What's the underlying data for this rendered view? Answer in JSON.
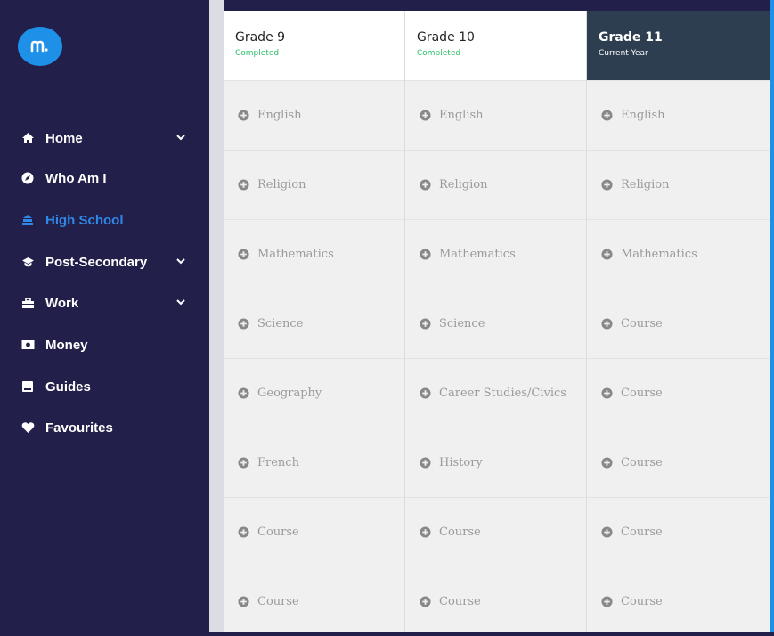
{
  "sidebar": {
    "logo_text": "m",
    "items": [
      {
        "label": "Home",
        "icon": "home-icon",
        "has_chevron": true
      },
      {
        "label": "Who Am I",
        "icon": "compass-icon",
        "has_chevron": false
      },
      {
        "label": "High School",
        "icon": "school-icon",
        "has_chevron": false,
        "active": true
      },
      {
        "label": "Post-Secondary",
        "icon": "graduation-cap-icon",
        "has_chevron": true
      },
      {
        "label": "Work",
        "icon": "briefcase-icon",
        "has_chevron": true
      },
      {
        "label": "Money",
        "icon": "money-icon",
        "has_chevron": false
      },
      {
        "label": "Guides",
        "icon": "book-icon",
        "has_chevron": false
      },
      {
        "label": "Favourites",
        "icon": "heart-icon",
        "has_chevron": false
      }
    ]
  },
  "grades": [
    {
      "title": "Grade 9",
      "status": "Completed",
      "current": false,
      "courses": [
        "English",
        "Religion",
        "Mathematics",
        "Science",
        "Geography",
        "French",
        "Course",
        "Course"
      ]
    },
    {
      "title": "Grade 10",
      "status": "Completed",
      "current": false,
      "courses": [
        "English",
        "Religion",
        "Mathematics",
        "Science",
        "Career Studies/Civics",
        "History",
        "Course",
        "Course"
      ]
    },
    {
      "title": "Grade 11",
      "status": "Current Year",
      "current": true,
      "courses": [
        "English",
        "Religion",
        "Mathematics",
        "Course",
        "Course",
        "Course",
        "Course",
        "Course"
      ]
    }
  ],
  "colors": {
    "sidebar": "#22204a",
    "accent": "#1e90e8",
    "active": "#2f87e8",
    "completed": "#2ebf6a",
    "current_header": "#2c3e50"
  }
}
